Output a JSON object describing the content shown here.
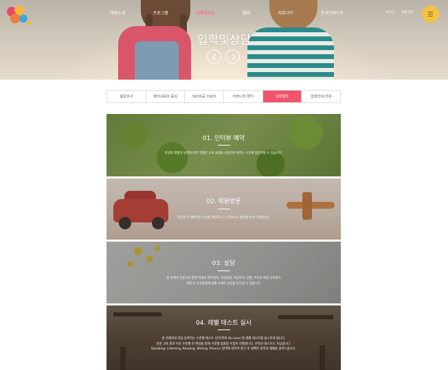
{
  "header": {
    "nav": [
      {
        "label": "채점소개",
        "active": false
      },
      {
        "label": "프로그램",
        "active": false
      },
      {
        "label": "입학및상담",
        "active": true
      },
      {
        "label": "캠퍼",
        "active": false
      },
      {
        "label": "커뮤니티",
        "active": false
      },
      {
        "label": "온라인테스트",
        "active": false
      }
    ],
    "util": {
      "login": "로그인",
      "join": "회원가입"
    },
    "menu_button_color": "#f5c242",
    "active_color": "#ff5a7e"
  },
  "hero": {
    "title": "입학및상담",
    "prev_icon": "chevron-left-icon",
    "next_icon": "chevron-right-icon"
  },
  "tabs": [
    {
      "label": "설문조사",
      "active": false
    },
    {
      "label": "영어교육의 중심",
      "active": false
    },
    {
      "label": "SDI성공 스토리",
      "active": false
    },
    {
      "label": "어머니의 편지",
      "active": false
    },
    {
      "label": "입학절차",
      "active": true
    },
    {
      "label": "입학안내 안내",
      "active": false
    }
  ],
  "steps": [
    {
      "title": "01. 인터뷰 예약",
      "lines": [
        "학생의 레벨과 능력에 따른 적절한 교육 과정을 상담하여 원하는 시간에 방문하실 수 있습니다."
      ]
    },
    {
      "title": "02. 학원방문",
      "lines": [
        "인터뷰 후 예약하신 시간을 확인하시고, 학원으로 방문해 주시기 바랍니다."
      ]
    },
    {
      "title": "03. 상담",
      "lines": [
        "원 관계자 전문교육 통한 학생의 영어실력, 사용방법, 학습목적, 상황, 부모의 희망 교육방식",
        "실제 전 교육과정에 대해 자세한 상담을 받으실 수 있습니다."
      ]
    },
    {
      "title": "04. 레벨 테스트 실시",
      "lines": [
        "원 관계자와 처음 등록하는 수준별 테스트 (인터뷰와 On-Line) 및 레벨 테스트를 실시하게 됩니다.",
        "전문 교육 결과 이후 수준별 반 편성을 통해 수준별 맞춤형 수업이 진행됩니다. 온라인 테스트도 가능합니다.",
        "Speaking, Listening, Reading, Writing, Phonics 영역에 대하여 평가 후 정확한 실력과 레벨을 알려드립니다."
      ]
    }
  ],
  "colors": {
    "tab_active": "#f2546e",
    "brand_pink": "#e8456b",
    "brand_yellow": "#f5b73b"
  }
}
